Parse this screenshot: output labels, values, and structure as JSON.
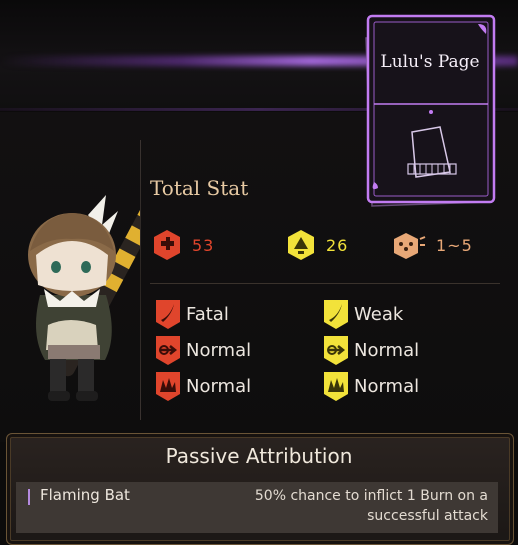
{
  "page_card": {
    "title": "Lulu's Page"
  },
  "total_stat": {
    "heading": "Total Stat",
    "hp": "53",
    "stagger": "26",
    "speed": "1~5"
  },
  "resistances": {
    "hp": [
      {
        "type": "slash",
        "label": "Fatal"
      },
      {
        "type": "pierce",
        "label": "Normal"
      },
      {
        "type": "blunt",
        "label": "Normal"
      }
    ],
    "stagger": [
      {
        "type": "slash",
        "label": "Weak"
      },
      {
        "type": "pierce",
        "label": "Normal"
      },
      {
        "type": "blunt",
        "label": "Normal"
      }
    ]
  },
  "passive": {
    "heading": "Passive Attribution",
    "items": [
      {
        "name": "Flaming Bat",
        "description": "50% chance to inflict 1 Burn on a successful attack"
      }
    ]
  },
  "colors": {
    "hp_red": "#e0452c",
    "stagger_yellow": "#f2e23a",
    "speed_orange": "#e8a877",
    "page_purple": "#c27cf2"
  }
}
